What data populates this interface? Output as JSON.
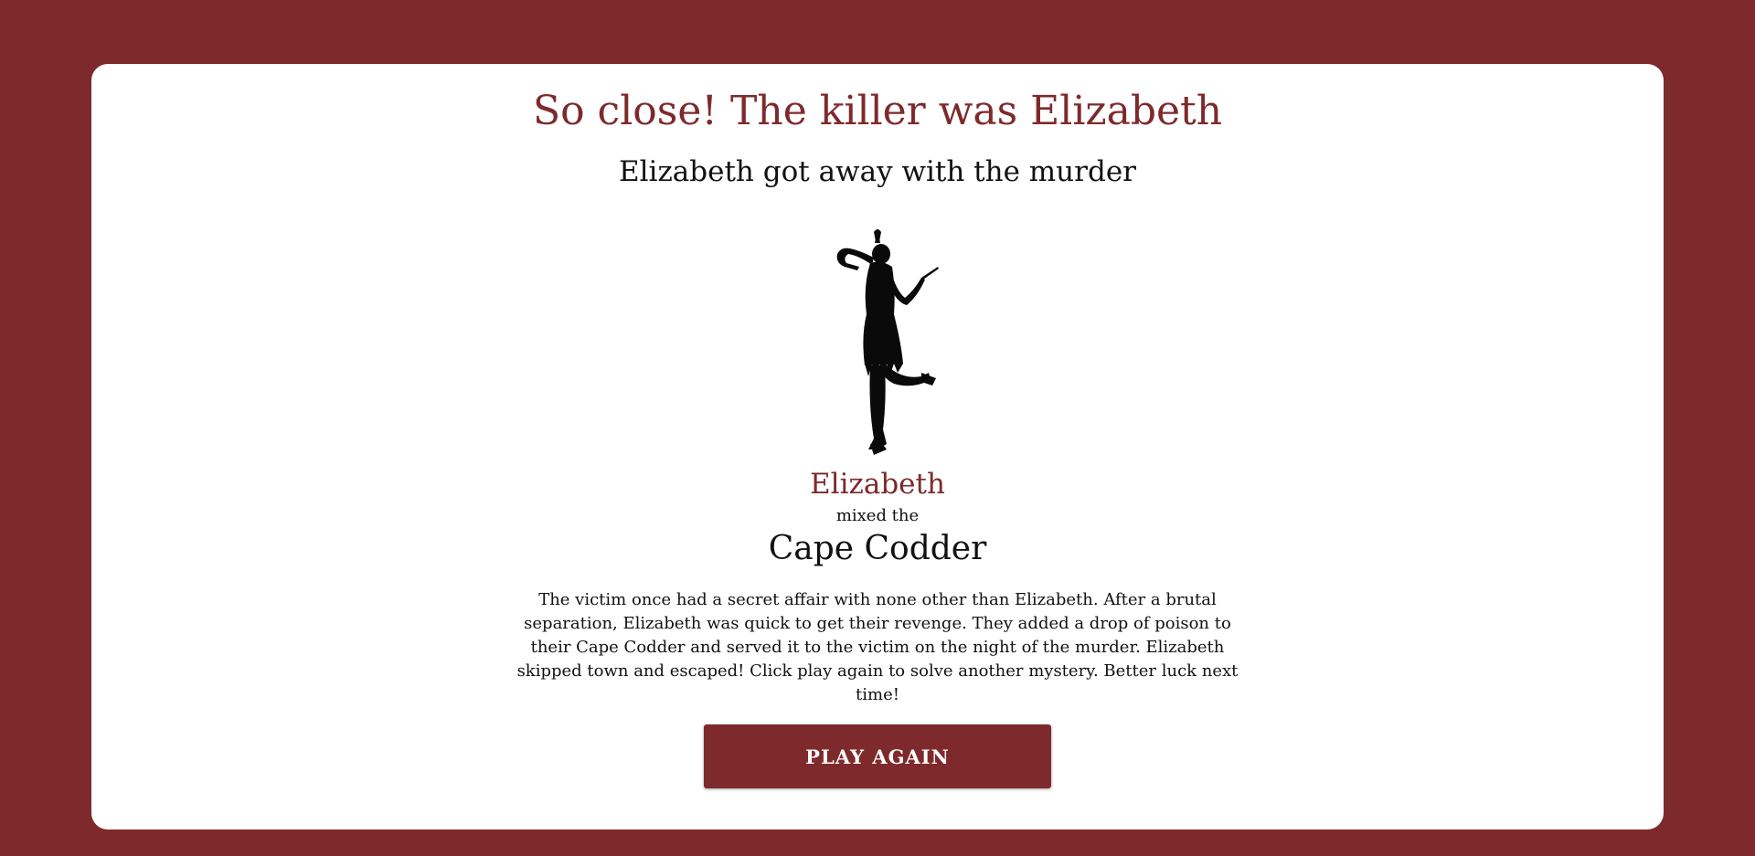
{
  "result": {
    "headline": "So close! The killer was Elizabeth",
    "subheadline": "Elizabeth got away with the murder"
  },
  "suspect": {
    "image": "flapper-dancer-silhouette-icon",
    "name": "Elizabeth",
    "connector": "mixed the",
    "drink": "Cape Codder"
  },
  "story": "The victim once had a secret affair with none other than Elizabeth. After a brutal separation, Elizabeth was quick to get their revenge. They added a drop of poison to their Cape Codder and served it to the victim on the night of the murder. Elizabeth skipped town and escaped! Click play again to solve another mystery. Better luck next time!",
  "actions": {
    "play_again_label": "PLAY AGAIN"
  },
  "colors": {
    "background": "#7e2a2c",
    "card": "#ffffff",
    "accent": "#7e2a2c",
    "text": "#111111"
  }
}
